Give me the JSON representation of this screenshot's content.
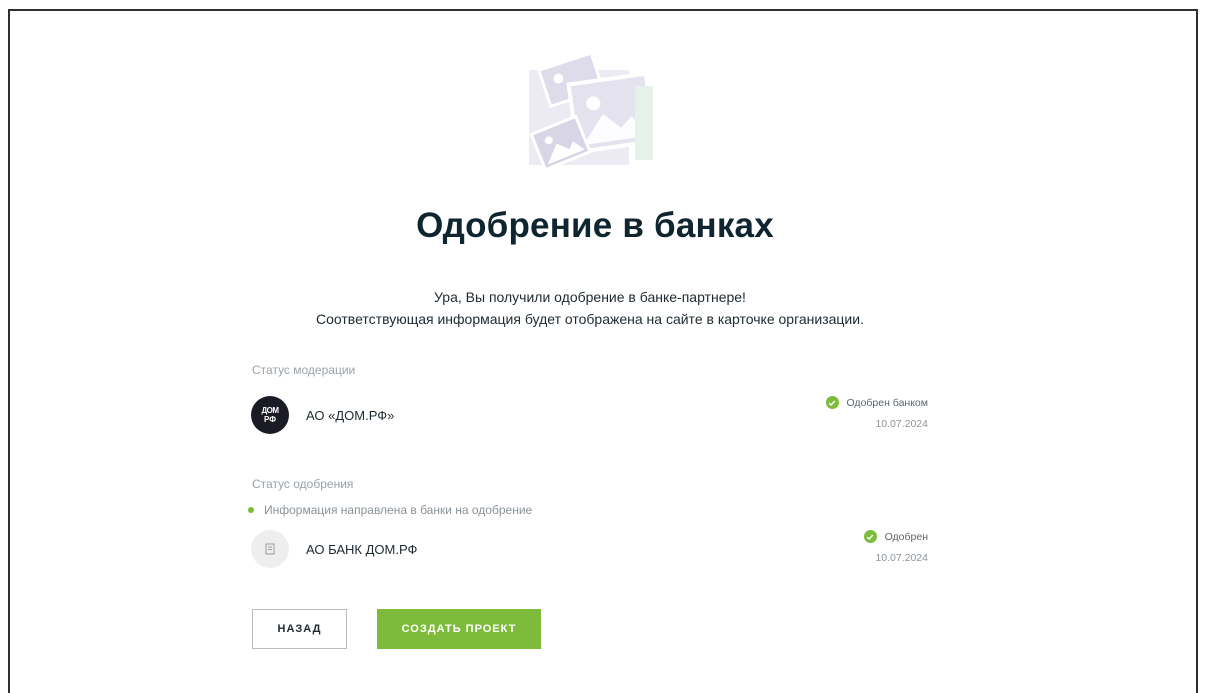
{
  "page": {
    "title": "Одобрение в банках",
    "subtitle_line1": "Ура, Вы получили одобрение в банке-партнере!",
    "subtitle_line2": "Соответствующая информация будет отображена на сайте в карточке организации."
  },
  "moderation": {
    "label": "Статус модерации",
    "bank": {
      "name": "АО «ДОМ.РФ»",
      "logo_text_top": "ДОМ",
      "logo_text_bottom": "РФ",
      "status": "Одобрен банком",
      "date": "10.07.2024"
    }
  },
  "approval": {
    "label": "Статус одобрения",
    "info": "Информация направлена в банки на одобрение",
    "bank": {
      "name": "АО БАНК ДОМ.РФ",
      "status": "Одобрен",
      "date": "10.07.2024"
    }
  },
  "buttons": {
    "back": "НАЗАД",
    "create": "СОЗДАТЬ ПРОЕКТ"
  },
  "colors": {
    "accent": "#7cbc3a",
    "title": "#0f2530"
  },
  "icons": {
    "illustration": "image-placeholder-icon",
    "check": "check-circle-icon"
  }
}
